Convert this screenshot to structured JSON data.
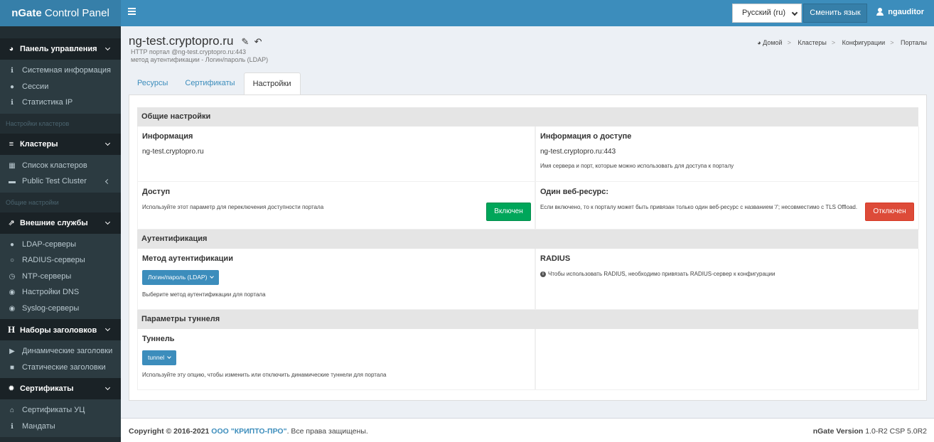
{
  "header": {
    "logo_bold": "nGate",
    "logo_rest": " Control Panel",
    "language": "Русский (ru)",
    "change_language": "Сменить язык",
    "username": "ngauditor"
  },
  "sidebar": {
    "dashboard": {
      "label": "Панель управления",
      "items": [
        "Системная информация",
        "Сессии",
        "Статистика IP"
      ]
    },
    "cluster_settings_label": "Настройки кластеров",
    "clusters": {
      "label": "Кластеры",
      "items": [
        "Список кластеров",
        "Public Test Cluster"
      ]
    },
    "general_settings_label": "Общие настройки",
    "external": {
      "label": "Внешние службы",
      "items": [
        "LDAP-серверы",
        "RADIUS-серверы",
        "NTP-серверы",
        "Настройки DNS",
        "Syslog-серверы"
      ]
    },
    "headers": {
      "label": "Наборы заголовков",
      "items": [
        "Динамические заголовки",
        "Статические заголовки"
      ]
    },
    "certs": {
      "label": "Сертификаты",
      "items": [
        "Сертификаты УЦ",
        "Мандаты"
      ]
    }
  },
  "page": {
    "title": "ng-test.cryptopro.ru",
    "subtitle1": "HTTP портал @ng-test.cryptopro.ru:443",
    "subtitle2": "метод аутентификации - Логин/пароль (LDAP)"
  },
  "breadcrumb": [
    "Домой",
    "Кластеры",
    "Конфигурации",
    "Порталы"
  ],
  "tabs": [
    "Ресурсы",
    "Сертификаты",
    "Настройки"
  ],
  "settings": {
    "general": {
      "title": "Общие настройки",
      "info_label": "Информация",
      "info_value": "ng-test.cryptopro.ru",
      "access_info_label": "Информация о доступе",
      "access_info_value": "ng-test.cryptopro.ru:443",
      "access_info_hint": "Имя сервера и порт, которые можно использовать для доступа к порталу",
      "access_label": "Доступ",
      "access_hint": "Используйте этот параметр для переключения доступности портала",
      "access_button": "Включен",
      "single_label": "Один веб-ресурс:",
      "single_hint": "Если включено, то к порталу может быть привязан только один веб-ресурс с названием '/'; несовместимо с TLS Offload.",
      "single_button": "Отключен"
    },
    "auth": {
      "title": "Аутентификация",
      "method_label": "Метод аутентификации",
      "method_value": "Логин/пароль (LDAP)",
      "method_hint": "Выберите метод аутентификации для портала",
      "radius_label": "RADIUS",
      "radius_hint": "Чтобы использовать RADIUS, необходимо привязать RADIUS-сервер к конфигурации"
    },
    "tunnel": {
      "title": "Параметры туннеля",
      "label": "Туннель",
      "value": "tunnel",
      "hint": "Используйте эту опцию, чтобы изменить или отключить динамические туннели для портала"
    }
  },
  "footer": {
    "copyright": "Copyright © 2016-2021",
    "company": "ООО \"КРИПТО-ПРО\"",
    "rights": ". Все права защищены.",
    "version_label": "nGate Version",
    "version_value": " 1.0-R2 CSP 5.0R2"
  }
}
